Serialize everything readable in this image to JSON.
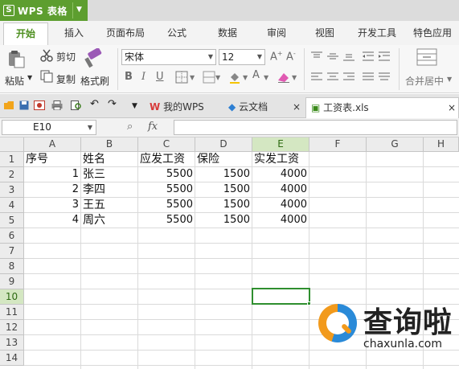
{
  "app": {
    "title": "WPS 表格",
    "logo_glyph": "S",
    "accent": "#5d9e2f"
  },
  "menu": {
    "tabs": [
      "开始",
      "插入",
      "页面布局",
      "公式",
      "数据",
      "审阅",
      "视图",
      "开发工具",
      "特色应用"
    ],
    "active": "开始"
  },
  "ribbon": {
    "paste": "粘贴",
    "cut": "剪切",
    "copy": "复制",
    "format_painter": "格式刷",
    "font_name": "宋体",
    "font_size": "12",
    "merge_center": "合并居中"
  },
  "doc_tabs": [
    {
      "label": "我的WPS",
      "icon": "wps-logo-icon"
    },
    {
      "label": "云文档",
      "icon": "cloud-cube-icon"
    },
    {
      "label": "工资表.xls",
      "icon": "spreadsheet-file-icon",
      "active": true
    }
  ],
  "formula_bar": {
    "name_box": "E10",
    "fx": "fx",
    "formula": ""
  },
  "sheet": {
    "columns": [
      "A",
      "B",
      "C",
      "D",
      "E",
      "F",
      "G",
      "H"
    ],
    "rows": [
      "1",
      "2",
      "3",
      "4",
      "5",
      "6",
      "7",
      "8",
      "9",
      "10",
      "11",
      "12",
      "13",
      "14"
    ],
    "headers": [
      "序号",
      "姓名",
      "应发工资",
      "保险",
      "实发工资"
    ],
    "data": [
      [
        "1",
        "张三",
        "5500",
        "1500",
        "4000"
      ],
      [
        "2",
        "李四",
        "5500",
        "1500",
        "4000"
      ],
      [
        "3",
        "王五",
        "5500",
        "1500",
        "4000"
      ],
      [
        "4",
        "周六",
        "5500",
        "1500",
        "4000"
      ]
    ],
    "selected_cell": "E10"
  },
  "watermark": {
    "text": "查询啦",
    "url": "chaxunla.com"
  }
}
